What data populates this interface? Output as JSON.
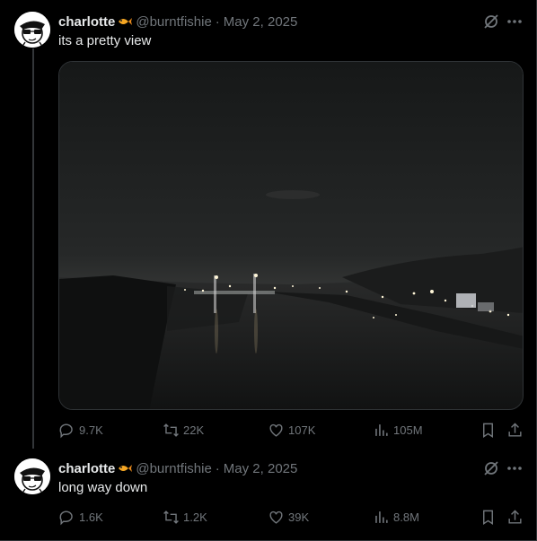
{
  "tweets": [
    {
      "name": "charlotte",
      "handle": "@burntfishie",
      "separator": "·",
      "date": "May 2, 2025",
      "text": "its a pretty view",
      "media_icon": "night-river-photo",
      "stats": {
        "replies": "9.7K",
        "retweets": "22K",
        "likes": "107K",
        "views": "105M"
      }
    },
    {
      "name": "charlotte",
      "handle": "@burntfishie",
      "separator": "·",
      "date": "May 2, 2025",
      "text": "long way down",
      "stats": {
        "replies": "1.6K",
        "retweets": "1.2K",
        "likes": "39K",
        "views": "8.8M"
      }
    }
  ],
  "colors": {
    "text": "#e7e9ea",
    "muted": "#71767b",
    "accent": "#1d9bf0",
    "border": "#2f3336"
  },
  "icons": [
    "reply-icon",
    "retweet-icon",
    "like-icon",
    "views-icon",
    "bookmark-icon",
    "share-icon",
    "grok-icon",
    "more-icon",
    "fish-emoji"
  ]
}
